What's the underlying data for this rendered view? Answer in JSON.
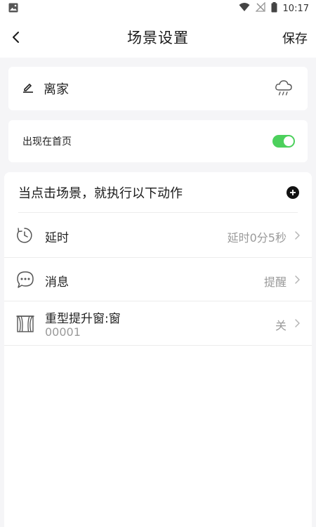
{
  "status_bar": {
    "time": "10:17"
  },
  "nav": {
    "title": "场景设置",
    "save_label": "保存"
  },
  "scene": {
    "name": "离家"
  },
  "home_toggle": {
    "label": "出现在首页",
    "on": true
  },
  "actions": {
    "title": "当点击场景，就执行以下动作",
    "items": [
      {
        "label": "延时",
        "value": "延时0分5秒",
        "icon": "timer-icon"
      },
      {
        "label": "消息",
        "value": "提醒",
        "icon": "message-icon"
      },
      {
        "label": "重型提升窗:窗",
        "sub": "00001",
        "value": "关",
        "icon": "curtain-icon"
      }
    ]
  },
  "colors": {
    "accent": "#4cd05c",
    "background": "#f5f5f7"
  }
}
